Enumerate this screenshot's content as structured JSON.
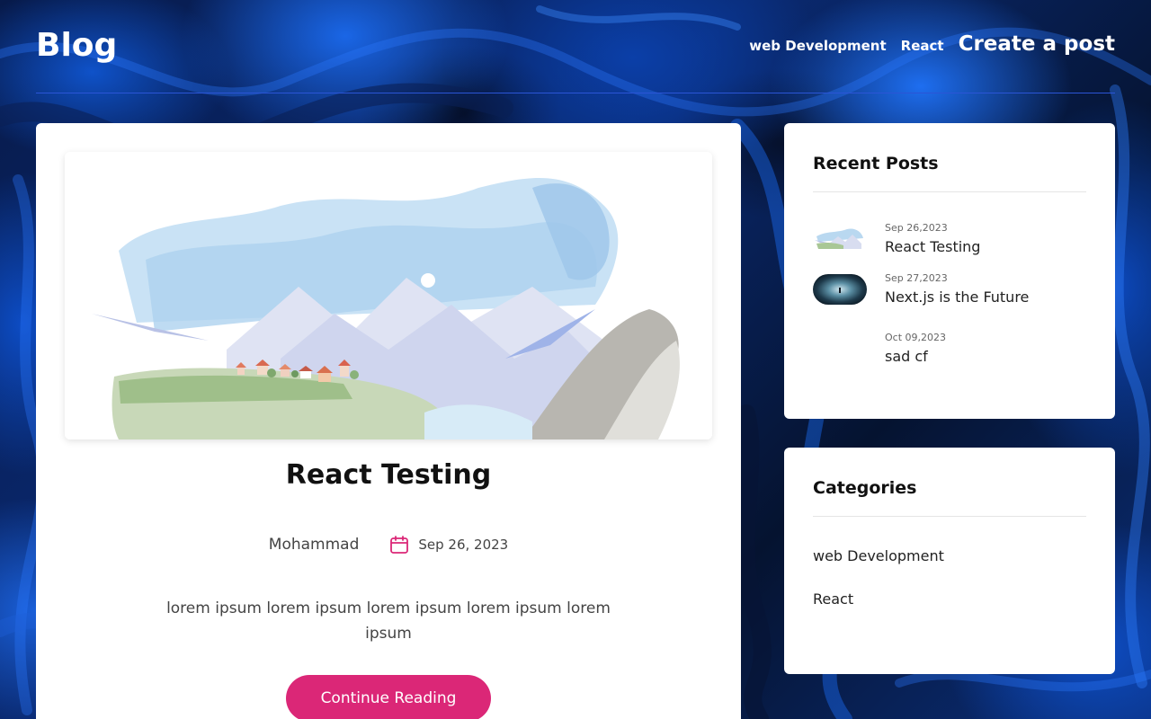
{
  "header": {
    "logo": "Blog",
    "nav": [
      "web Development",
      "React"
    ],
    "create_label": "Create a post"
  },
  "post": {
    "title": "React Testing",
    "author": "Mohammad",
    "date": "Sep 26, 2023",
    "excerpt": "lorem ipsum lorem ipsum lorem ipsum lorem ipsum lorem ipsum",
    "button_label": "Continue Reading",
    "image": "watercolor-landscape"
  },
  "recent": {
    "title": "Recent Posts",
    "items": [
      {
        "date": "Sep 26,2023",
        "title": "React Testing",
        "thumb": "watercolor-landscape"
      },
      {
        "date": "Sep 27,2023",
        "title": "Next.js is the Future",
        "thumb": "dark-lens-photo"
      },
      {
        "date": "Oct 09,2023",
        "title": "sad cf",
        "thumb": ""
      }
    ]
  },
  "categories": {
    "title": "Categories",
    "items": [
      "web Development",
      "React"
    ]
  },
  "colors": {
    "accent": "#db2777",
    "background": "#0a2a72",
    "card": "#ffffff",
    "divider": "#2b55d6"
  },
  "icons": {
    "calendar": "calendar-icon"
  }
}
